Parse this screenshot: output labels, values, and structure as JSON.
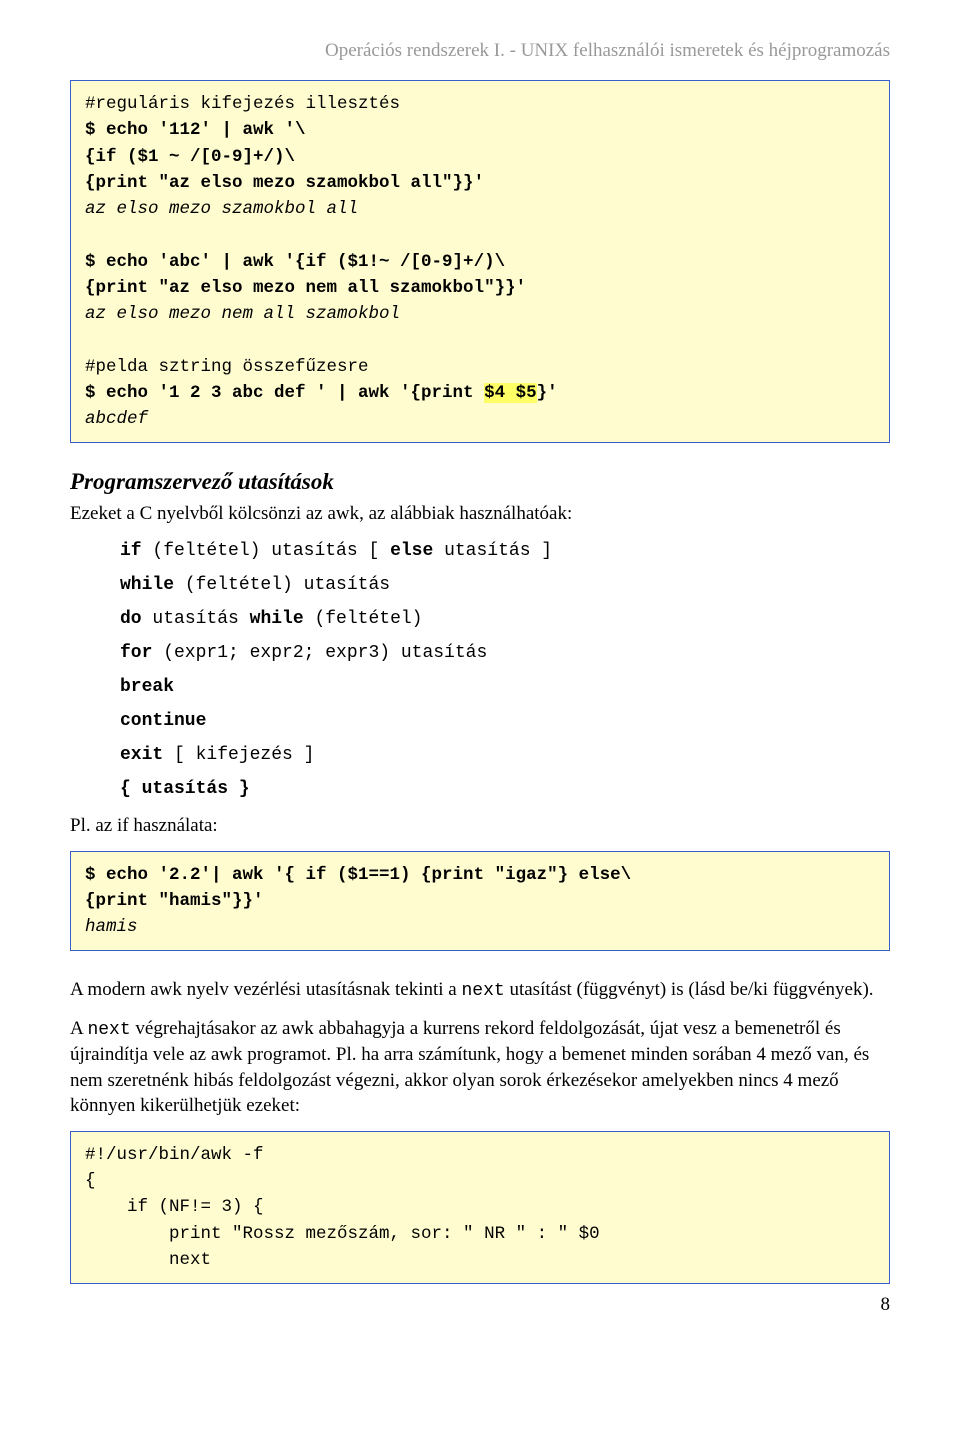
{
  "header": "Operációs rendszerek I. - UNIX felhasználói ismeretek és héjprogramozás",
  "code1": {
    "l1": "#reguláris kifejezés illesztés",
    "l2": "$ echo '112' | awk '\\",
    "l3": "{if ($1 ~ /[0-9]+/)\\",
    "l4": "{print \"az elso mezo szamokbol all\"}}'",
    "l5": "az elso mezo szamokbol all",
    "l6": "",
    "l7": "$ echo 'abc' | awk '{if ($1.!~ /[0-9]+/)\\",
    "l8": "{print \"az elso mezo nem all szamokbol\"}}'",
    "l9": "az elso mezo nem all szamokbol",
    "l10": "",
    "l11": "#pelda sztring összefűzesre",
    "l12a": "$ echo '1 2 3 abc def ' | awk '{print ",
    "l12b": "$4 $5",
    "l12c": "}'",
    "l13": "abcdef"
  },
  "section_title": "Programszervező utasítások",
  "intro": "Ezeket  a C nyelvből kölcsönzi az awk, az alábbiak használhatóak:",
  "syntax": {
    "s1a": "if",
    "s1b": " (feltétel) utasítás [ ",
    "s1c": "else",
    "s1d": " utasítás ]",
    "s2a": "while",
    "s2b": " (feltétel) utasítás",
    "s3a": "do",
    "s3b": " utasítás ",
    "s3c": "while",
    "s3d": " (feltétel)",
    "s4a": "for",
    "s4b": " (expr1; expr2; expr3) utasítás",
    "s5": "break",
    "s6": "continue",
    "s7a": "exit",
    "s7b": " [ kifejezés ]",
    "s8": "{ utasítás }"
  },
  "example_label": "Pl. az if használata:",
  "code2": {
    "l1": "$ echo '2.2'| awk '{ if ($1==1) {print \"igaz\"} else\\",
    "l2": "{print \"hamis\"}}'",
    "l3": "hamis"
  },
  "para1a": "A modern awk nyelv vezérlési utasításnak tekinti a ",
  "para1b": "next",
  "para1c": " utasítást (függvényt) is (lásd be/ki függvények).",
  "para2a": "A ",
  "para2b": "next",
  "para2c": " végrehajtásakor az awk abbahagyja a kurrens rekord feldolgozását, újat vesz a bemenetről és újraindítja vele az awk programot. Pl. ha arra számítunk, hogy a bemenet minden sorában 4 mező van, és nem szeretnénk hibás feldolgozást végezni, akkor olyan sorok érkezésekor amelyekben nincs 4 mező könnyen kikerülhetjük ezeket:",
  "code3": {
    "l1": "#!/usr/bin/awk -f",
    "l2": "{",
    "l3": "    if (NF.!= 3) {",
    "l4": "        print \"Rossz mezőszám, sor: \" NR \" : \" $0",
    "l5": "        next"
  },
  "page_number": "8"
}
